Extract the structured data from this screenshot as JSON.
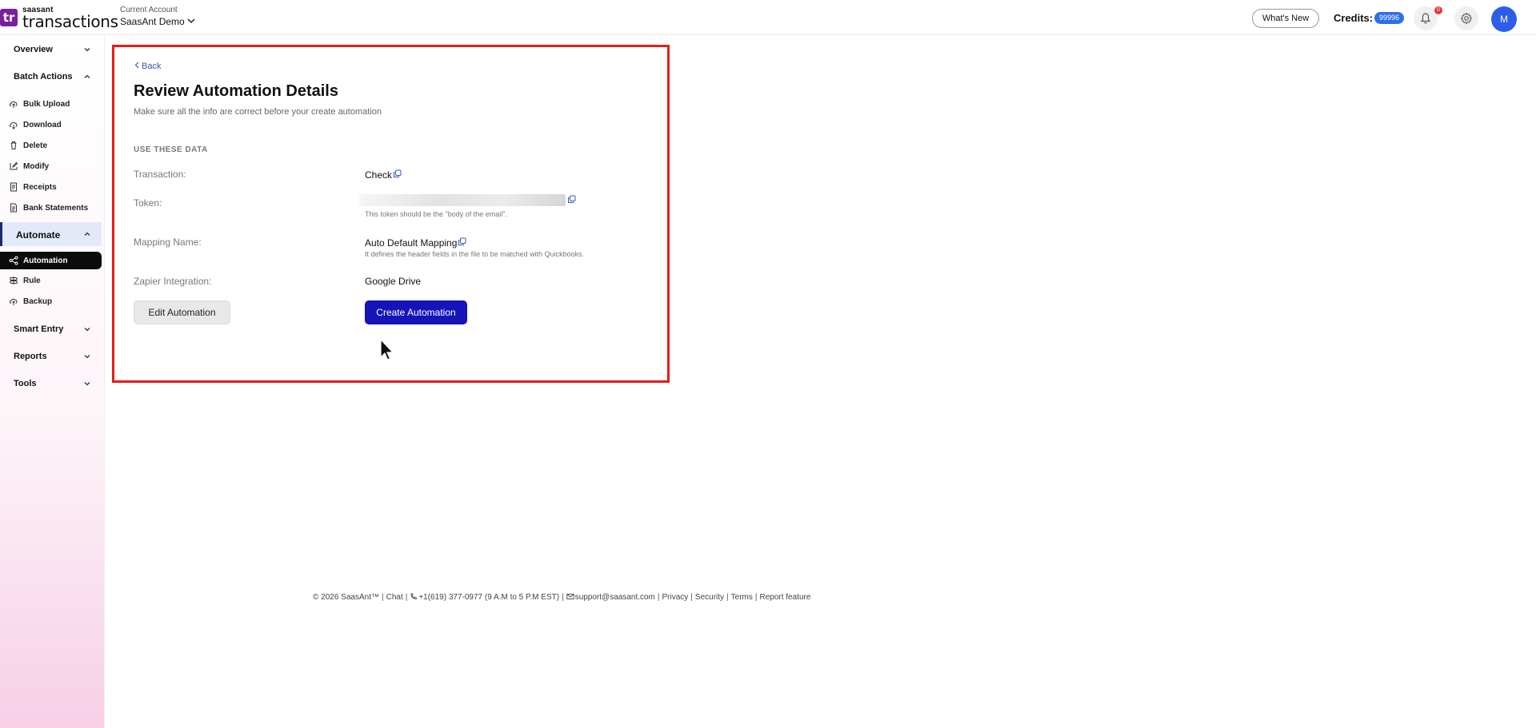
{
  "header": {
    "brand": "saasant",
    "product": "transactions",
    "logo_letters": "tr",
    "account_label": "Current Account",
    "account_name": "SaasAnt Demo",
    "whats_new": "What's New",
    "credits_label": "Credits:",
    "credits_value": "99996",
    "notification_count": "0",
    "avatar_initial": "M"
  },
  "sidebar": {
    "overview": "Overview",
    "batch_actions": "Batch Actions",
    "batch_items": [
      "Bulk Upload",
      "Download",
      "Delete",
      "Modify",
      "Receipts",
      "Bank Statements"
    ],
    "automate": "Automate",
    "automate_items": [
      "Automation",
      "Rule",
      "Backup"
    ],
    "smart_entry": "Smart Entry",
    "reports": "Reports",
    "tools": "Tools"
  },
  "main": {
    "back": "Back",
    "title": "Review Automation Details",
    "subtitle": "Make sure all the info are correct before your create automation",
    "section_label": "USE THESE DATA",
    "rows": {
      "transaction_label": "Transaction:",
      "transaction_value": "Check",
      "token_label": "Token:",
      "token_hint": "This token should be the \"body of the email\".",
      "mapping_label": "Mapping Name:",
      "mapping_value": "Auto Default Mapping",
      "mapping_hint": "It defines the header fields in the file to be matched with Quickbooks.",
      "zapier_label": "Zapier Integration:",
      "zapier_value": "Google Drive"
    },
    "edit_button": "Edit Automation",
    "create_button": "Create Automation"
  },
  "footer": {
    "copyright": "© 2026 SaasAnt™",
    "chat": "Chat",
    "phone": "+1(619) 377-0977 (9 A.M to 5 P.M EST)",
    "email": "support@saasant.com",
    "privacy": "Privacy",
    "security": "Security",
    "terms": "Terms",
    "report": "Report feature"
  },
  "colors": {
    "accent": "#1414b8",
    "highlight_border": "#e51c1c",
    "avatar": "#2c5ee8",
    "credits_badge": "#2f6fe8",
    "brand_purple": "#7b1fa2"
  }
}
